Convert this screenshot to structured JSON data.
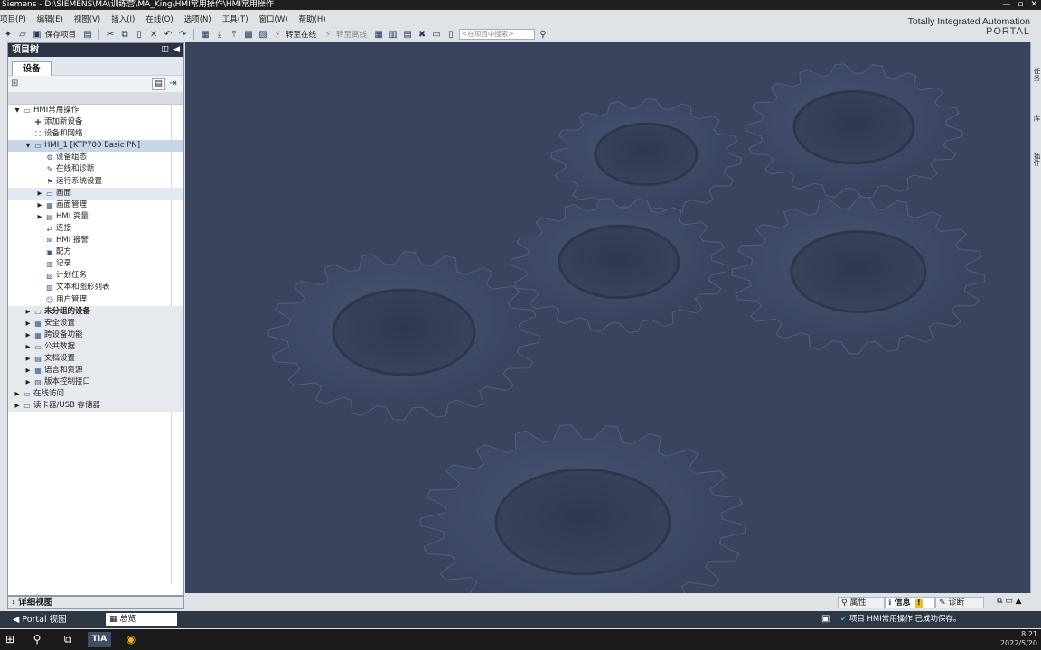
{
  "window": {
    "title": "Siemens  -  D:\\SIEMENS\\MA\\训练营\\MA_King\\HMI常用操作\\HMI常用操作",
    "controls": [
      "—",
      "▫",
      "✕"
    ]
  },
  "menu": [
    "项目(P)",
    "编辑(E)",
    "视图(V)",
    "插入(I)",
    "在线(O)",
    "选项(N)",
    "工具(T)",
    "窗口(W)",
    "帮助(H)"
  ],
  "brand": {
    "line1": "Totally Integrated Automation",
    "line2": "PORTAL"
  },
  "toolbar": {
    "save_project": "保存项目",
    "go_online": "转至在线",
    "go_offline": "转至离线",
    "search_placeholder": "<在项目中搜索>"
  },
  "tree": {
    "title": "项目树",
    "tab": "设备",
    "items": [
      {
        "label": "HMI常用操作",
        "level": 0,
        "arrow": "▼",
        "icon": "▭"
      },
      {
        "label": "添加新设备",
        "level": 1,
        "arrow": "",
        "icon": "✚"
      },
      {
        "label": "设备和网络",
        "level": 1,
        "arrow": "",
        "icon": "⛶"
      },
      {
        "label": "HMI_1 [KTP700 Basic PN]",
        "level": 1,
        "arrow": "▼",
        "icon": "▭",
        "selected": true
      },
      {
        "label": "设备组态",
        "level": 2,
        "arrow": "",
        "icon": "⚙"
      },
      {
        "label": "在线和诊断",
        "level": 2,
        "arrow": "",
        "icon": "✎"
      },
      {
        "label": "运行系统设置",
        "level": 2,
        "arrow": "",
        "icon": "⚑"
      },
      {
        "label": "画面",
        "level": 2,
        "arrow": "▶",
        "icon": "▭",
        "hover": true
      },
      {
        "label": "画面管理",
        "level": 2,
        "arrow": "▶",
        "icon": "▦"
      },
      {
        "label": "HMI 变量",
        "level": 2,
        "arrow": "▶",
        "icon": "▤"
      },
      {
        "label": "连接",
        "level": 2,
        "arrow": "",
        "icon": "⇄"
      },
      {
        "label": "HMI 报警",
        "level": 2,
        "arrow": "",
        "icon": "✉"
      },
      {
        "label": "配方",
        "level": 2,
        "arrow": "",
        "icon": "▣"
      },
      {
        "label": "记录",
        "level": 2,
        "arrow": "",
        "icon": "▥"
      },
      {
        "label": "计划任务",
        "level": 2,
        "arrow": "",
        "icon": "▧"
      },
      {
        "label": "文本和图形列表",
        "level": 2,
        "arrow": "",
        "icon": "▨"
      },
      {
        "label": "用户管理",
        "level": 2,
        "arrow": "",
        "icon": "☺"
      },
      {
        "label": "未分组的设备",
        "level": 1,
        "arrow": "▶",
        "icon": "▭",
        "bold": true,
        "section": true
      },
      {
        "label": "安全设置",
        "level": 1,
        "arrow": "▶",
        "icon": "▦",
        "section": true
      },
      {
        "label": "跨设备功能",
        "level": 1,
        "arrow": "▶",
        "icon": "▦",
        "section": true
      },
      {
        "label": "公共数据",
        "level": 1,
        "arrow": "▶",
        "icon": "▭",
        "section": true
      },
      {
        "label": "文档设置",
        "level": 1,
        "arrow": "▶",
        "icon": "▤",
        "section": true
      },
      {
        "label": "语言和资源",
        "level": 1,
        "arrow": "▶",
        "icon": "▦",
        "section": true
      },
      {
        "label": "版本控制接口",
        "level": 1,
        "arrow": "▶",
        "icon": "▧",
        "section": true
      },
      {
        "label": "在线访问",
        "level": 0,
        "arrow": "▶",
        "icon": "▭",
        "section": true
      },
      {
        "label": "读卡器/USB 存储器",
        "level": 0,
        "arrow": "▶",
        "icon": "▭",
        "section": true
      }
    ]
  },
  "detail_view": "详细视图",
  "right_tabs": [
    "任务",
    "库",
    "插件"
  ],
  "inspector_tabs": [
    "属性",
    "信息",
    "诊断"
  ],
  "status": {
    "portal": "Portal 视图",
    "overview": "总览",
    "message": "项目 HMI常用操作 已成功保存。"
  },
  "taskbar": {
    "time": "8:21",
    "date": "2022/5/20"
  },
  "colors": {
    "workspace": "#39455e",
    "panel_header": "#2b3445",
    "statusbar": "#2d3746",
    "selection": "#c8d6ea"
  }
}
